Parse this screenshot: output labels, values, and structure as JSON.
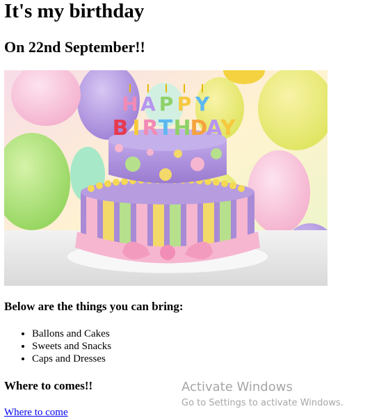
{
  "page": {
    "title": "It's my birthday",
    "subtitle": "On 22nd September!!",
    "image": {
      "name": "birthday-cake-image",
      "cake_letters_top": [
        "H",
        "A",
        "P",
        "P",
        "Y"
      ],
      "cake_letters_bottom": [
        "B",
        "I",
        "R",
        "T",
        "H",
        "D",
        "A",
        "Y"
      ]
    },
    "bring_heading": "Below are the things you can bring:",
    "bring_items": [
      "Ballons and Cakes",
      "Sweets and Snacks",
      "Caps and Dresses"
    ],
    "where_heading": "Where to comes!!",
    "where_link": "Where to come"
  },
  "watermark": {
    "title": "Activate Windows",
    "subtitle": "Go to Settings to activate Windows."
  },
  "colors": {
    "link": "#0000ee",
    "watermark": "#a6a6a6",
    "cake_purple": "#a98ad6",
    "cake_pink": "#f6b6cf",
    "cake_yellow": "#f3d96a"
  }
}
